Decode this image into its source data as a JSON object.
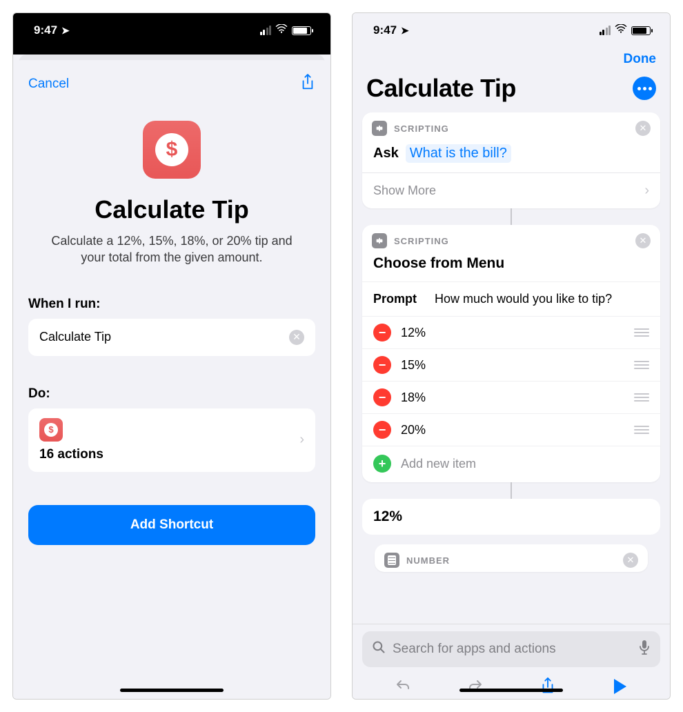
{
  "status": {
    "time": "9:47"
  },
  "left": {
    "cancel": "Cancel",
    "title": "Calculate Tip",
    "description": "Calculate a 12%, 15%, 18%, or 20% tip and your total from the given amount.",
    "when_label": "When I run:",
    "when_value": "Calculate Tip",
    "do_label": "Do:",
    "actions_count": "16 actions",
    "add_button": "Add Shortcut"
  },
  "right": {
    "done": "Done",
    "title": "Calculate Tip",
    "scripting_label": "SCRIPTING",
    "ask_label": "Ask",
    "ask_token": "What is the bill?",
    "show_more": "Show More",
    "choose_title": "Choose from Menu",
    "prompt_key": "Prompt",
    "prompt_value": "How much would you like to tip?",
    "options": [
      "12%",
      "15%",
      "18%",
      "20%"
    ],
    "add_item": "Add new item",
    "branch_label": "12%",
    "number_label": "NUMBER",
    "search_placeholder": "Search for apps and actions"
  }
}
